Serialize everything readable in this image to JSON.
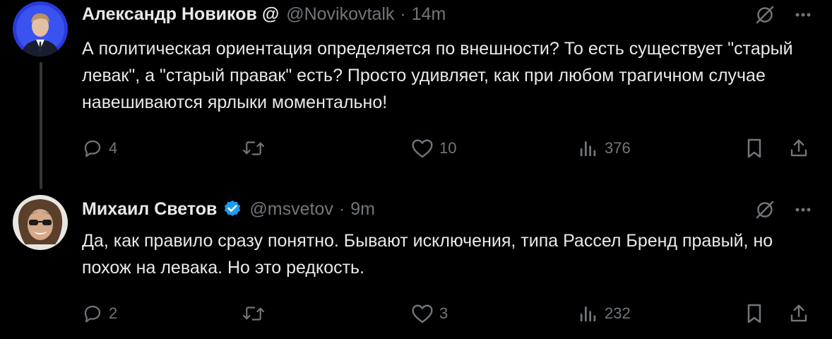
{
  "tweets": [
    {
      "author": {
        "name": "Александр Новиков @",
        "handle": "@Novikovtalk",
        "separator": "·",
        "time": "14m",
        "verified": false
      },
      "text": "А политическая ориентация определяется по внешности? То есть существует \"старый левак\", а \"старый правак\" есть? Просто удивляет, как при любом трагичном случае навешиваются ярлыки моментально!",
      "stats": {
        "replies": "4",
        "retweets": "",
        "likes": "10",
        "views": "376"
      }
    },
    {
      "author": {
        "name": "Михаил Светов",
        "handle": "@msvetov",
        "separator": "·",
        "time": "9m",
        "verified": true
      },
      "text": "Да, как правило сразу понятно. Бывают исключения, типа Рассел Бренд правый, но похож на левака. Но это редкость.",
      "stats": {
        "replies": "2",
        "retweets": "",
        "likes": "3",
        "views": "232"
      }
    }
  ],
  "colors": {
    "background": "#000000",
    "text_primary": "#e7e9ea",
    "text_secondary": "#71767b",
    "verified_badge": "#1d9bf0",
    "thread_line": "#333639"
  },
  "icons": [
    "reply-icon",
    "retweet-icon",
    "like-icon",
    "views-icon",
    "bookmark-icon",
    "share-icon",
    "grok-icon",
    "more-icon",
    "verified-icon"
  ]
}
